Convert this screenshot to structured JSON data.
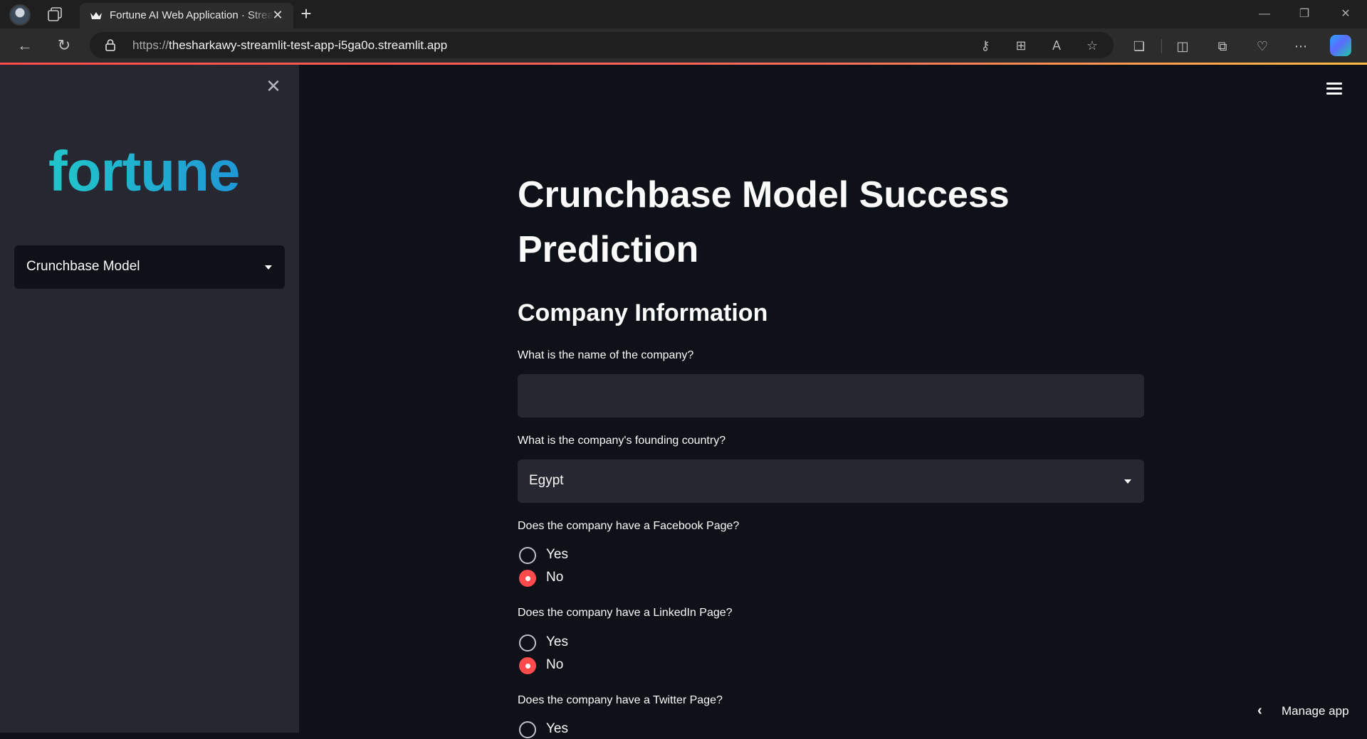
{
  "browser": {
    "tab_title": "Fortune AI Web Application · Streamlit",
    "new_tab_icon": "+",
    "url_scheme": "https://",
    "url_host": "thesharkawy-streamlit-test-app-i5ga0o.streamlit.app",
    "window_controls": [
      "minimize",
      "restore",
      "close"
    ]
  },
  "sidebar": {
    "logo_text": "fortune",
    "page_select_value": "Crunchbase Model"
  },
  "main": {
    "title": "Crunchbase Model Success Prediction",
    "section_header": "Company Information",
    "company_name": {
      "label": "What is the name of the company?",
      "value": ""
    },
    "founding_country": {
      "label": "What is the company's founding country?",
      "value": "Egypt"
    },
    "facebook": {
      "label": "Does the company have a Facebook Page?",
      "options": [
        "Yes",
        "No"
      ],
      "selected": "No"
    },
    "linkedin": {
      "label": "Does the company have a LinkedIn Page?",
      "options": [
        "Yes",
        "No"
      ],
      "selected": "No"
    },
    "twitter": {
      "label": "Does the company have a Twitter Page?",
      "options": [
        "Yes"
      ]
    }
  },
  "footer": {
    "manage_app_label": "Manage app"
  },
  "colors": {
    "accent": "#ff4b4b",
    "app_bg": "#0e1117",
    "sidebar_bg": "#262730",
    "logo": "#21c6c9"
  }
}
